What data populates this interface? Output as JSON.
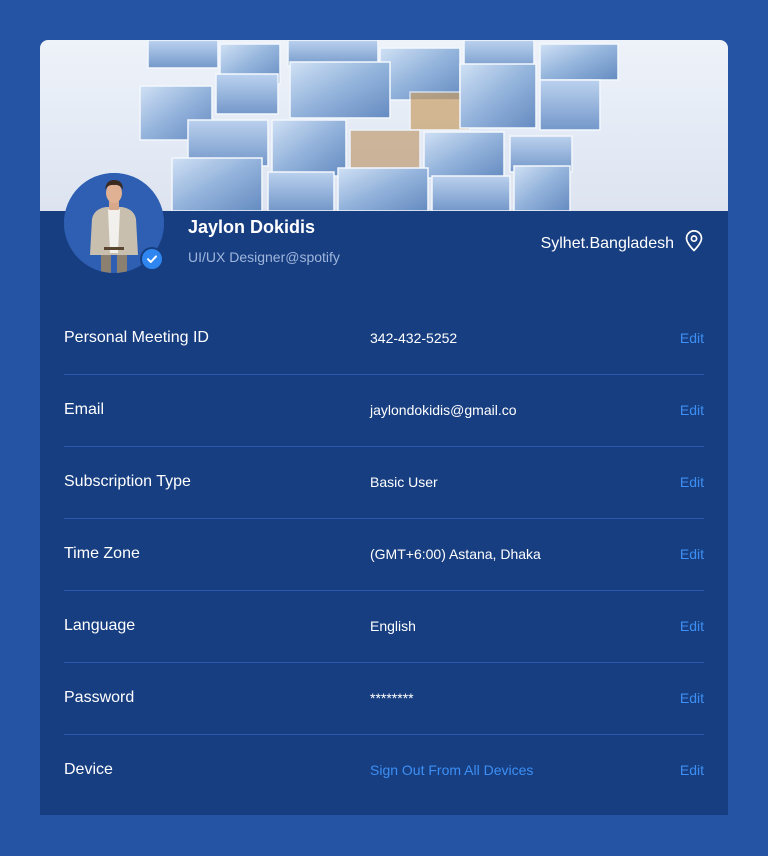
{
  "profile": {
    "name": "Jaylon Dokidis",
    "role": "UI/UX Designer@spotify",
    "location": "Sylhet.Bangladesh"
  },
  "icons": {
    "verified": "verified-check-icon",
    "location": "location-pin-icon"
  },
  "colors": {
    "page_background": "#2654A4",
    "card_background": "#173E80",
    "accent": "#3D8FF5"
  },
  "rows": [
    {
      "label": "Personal Meeting ID",
      "value": "342-432-5252",
      "action": "Edit"
    },
    {
      "label": "Email",
      "value": "jaylondokidis@gmail.co",
      "action": "Edit"
    },
    {
      "label": "Subscription Type",
      "value": "Basic User",
      "action": "Edit"
    },
    {
      "label": "Time Zone",
      "value": "(GMT+6:00) Astana, Dhaka",
      "action": "Edit"
    },
    {
      "label": "Language",
      "value": "English",
      "action": "Edit"
    },
    {
      "label": "Password",
      "value": "********",
      "action": "Edit"
    },
    {
      "label": "Device",
      "value": "Sign Out From All Devices",
      "action": "Edit"
    }
  ]
}
